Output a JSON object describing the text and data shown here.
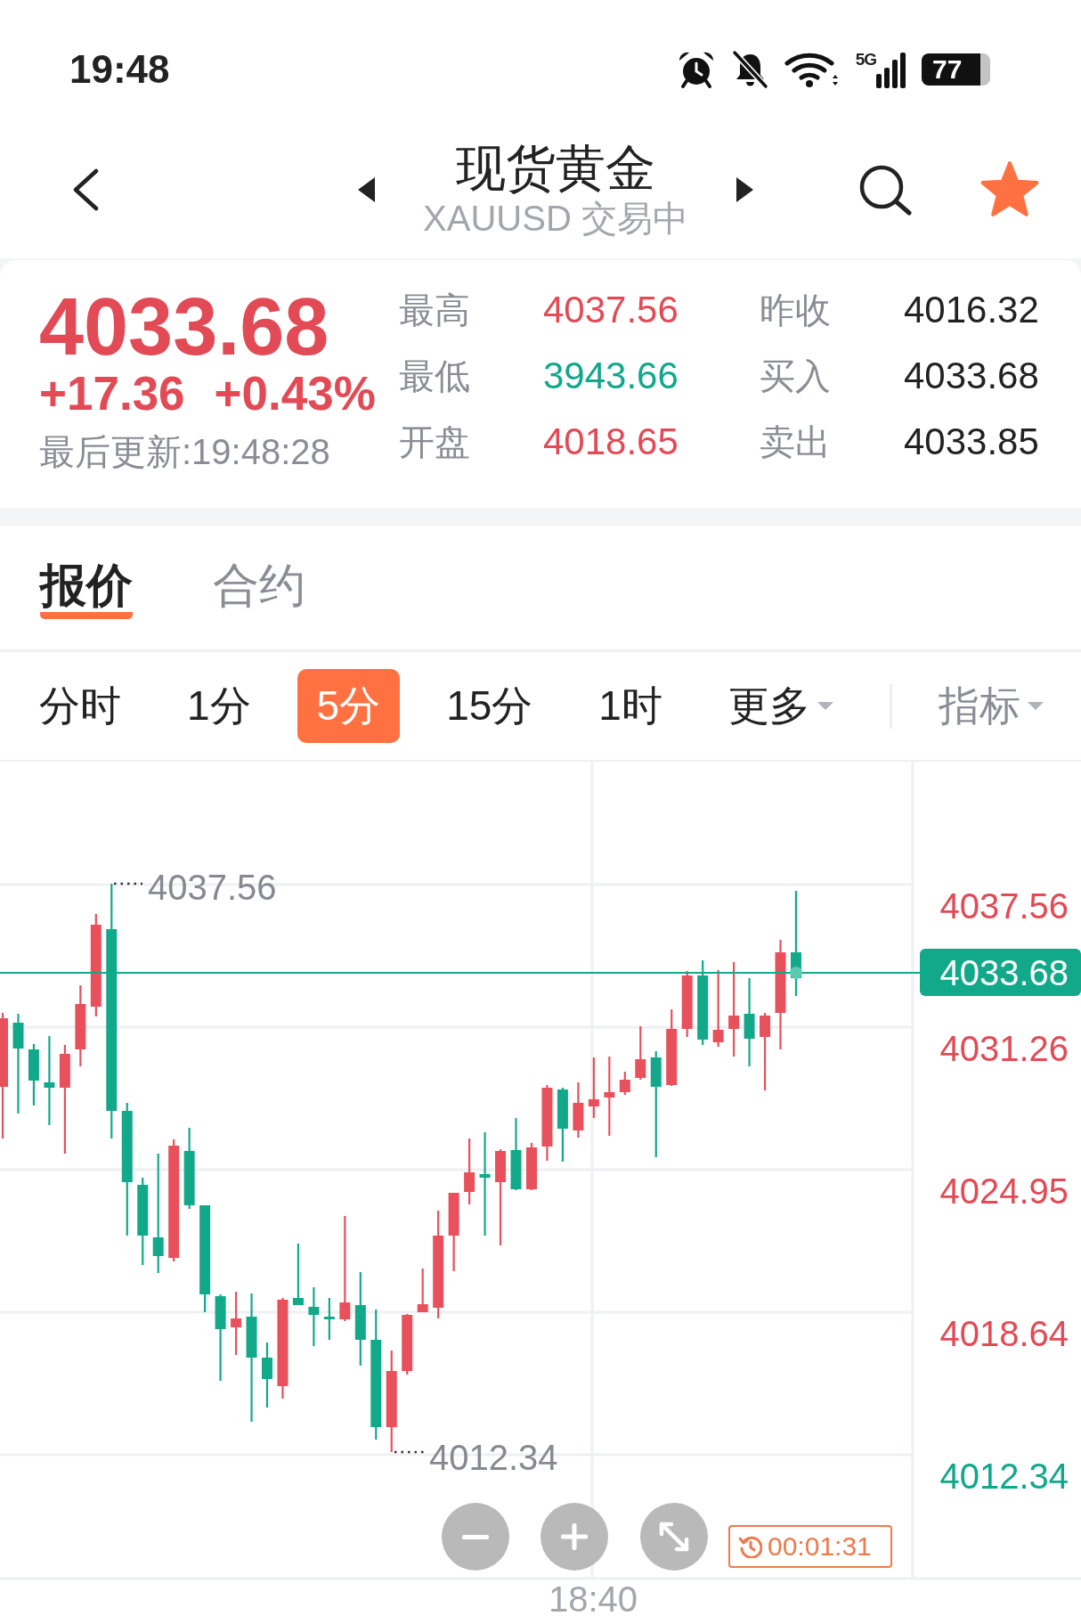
{
  "status_bar": {
    "time": "19:48",
    "network": "5G",
    "battery": "77"
  },
  "header": {
    "title": "现货黄金",
    "subtitle": "XAUUSD 交易中",
    "favorite": true
  },
  "quote": {
    "price": "4033.68",
    "change": "+17.36",
    "change_percent": "+0.43%",
    "rising": true,
    "updated": "最后更新:19:48:28",
    "stats": [
      {
        "label": "最高",
        "value": "4037.56",
        "color": "#e24a55"
      },
      {
        "label": "昨收",
        "value": "4016.32",
        "color": "#222222"
      },
      {
        "label": "最低",
        "value": "3943.66",
        "color": "#0fa88a"
      },
      {
        "label": "买入",
        "value": "4033.68",
        "color": "#222222"
      },
      {
        "label": "开盘",
        "value": "4018.65",
        "color": "#e24a55"
      },
      {
        "label": "卖出",
        "value": "4033.85",
        "color": "#222222"
      }
    ]
  },
  "tabs": [
    {
      "label": "报价",
      "selected": true
    },
    {
      "label": "合约",
      "selected": false
    }
  ],
  "periods": [
    {
      "label": "分时",
      "kind": "option",
      "selected": false
    },
    {
      "label": "1分",
      "kind": "option",
      "selected": false
    },
    {
      "label": "5分",
      "kind": "option",
      "selected": true
    },
    {
      "label": "15分",
      "kind": "option",
      "selected": false
    },
    {
      "label": "1时",
      "kind": "option",
      "selected": false
    },
    {
      "label": "更多",
      "kind": "dropdown",
      "selected": false
    }
  ],
  "indicator": {
    "label": "指标"
  },
  "chart": {
    "y_labels": [
      {
        "text": "4037.56",
        "color": "#e24a55"
      },
      {
        "text": "4031.26",
        "color": "#e24a55"
      },
      {
        "text": "4024.95",
        "color": "#e24a55"
      },
      {
        "text": "4018.64",
        "color": "#e24a55"
      },
      {
        "text": "4012.34",
        "color": "#0fa88a"
      }
    ],
    "current_price": "4033.68",
    "high_label": "4037.56",
    "low_label": "4012.34",
    "x_labels": [
      "18:40"
    ],
    "timer": "00:01:31"
  }
}
